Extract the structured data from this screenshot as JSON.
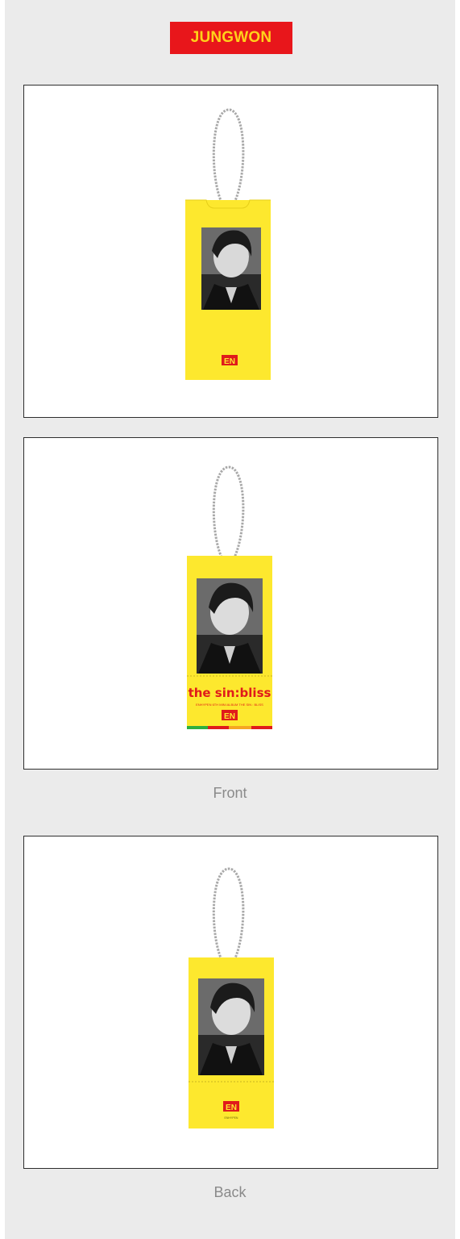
{
  "header": {
    "member_name": "JUNGWON"
  },
  "panels": [
    {
      "logo": "EN",
      "sample_text": ""
    },
    {
      "logo": "EN",
      "album_title": "the sin:bliss",
      "album_subtitle": "ENHYPEN 6TH MINI ALBUM THE SIN : BLISS"
    },
    {
      "logo": "EN",
      "back_text": "ENHYPEN"
    }
  ],
  "captions": {
    "front": "Front",
    "back": "Back"
  },
  "colors": {
    "badge_bg": "#e8161b",
    "badge_text": "#ffd21a",
    "card_yellow": "#fde82e",
    "logo_red": "#e01b1b"
  }
}
